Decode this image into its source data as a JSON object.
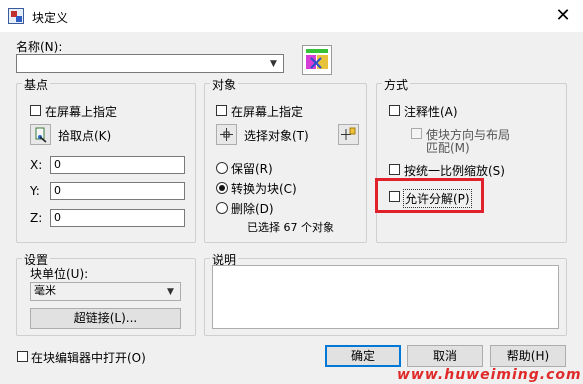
{
  "window": {
    "title": "块定义",
    "close_symbol": "✕"
  },
  "name": {
    "label": "名称(N):",
    "value": ""
  },
  "base_point": {
    "title": "基点",
    "on_screen_label": "在屏幕上指定",
    "pick_point_label": "拾取点(K)",
    "x_label": "X:",
    "x_value": "0",
    "y_label": "Y:",
    "y_value": "0",
    "z_label": "Z:",
    "z_value": "0"
  },
  "objects": {
    "title": "对象",
    "on_screen_label": "在屏幕上指定",
    "select_objects_label": "选择对象(T)",
    "retain_label": "保留(R)",
    "convert_label": "转换为块(C)",
    "delete_label": "删除(D)",
    "selected_count_label": "已选择 67 个对象",
    "selected_option": "convert"
  },
  "behavior": {
    "title": "方式",
    "annotative_label": "注释性(A)",
    "match_orientation_line1": "使块方向与布局",
    "match_orientation_line2": "匹配(M)",
    "scale_uniformly_label": "按统一比例缩放(S)",
    "allow_exploding_label": "允许分解(P)",
    "highlight_color": "#e0202a"
  },
  "settings": {
    "title": "设置",
    "block_unit_label": "块单位(U):",
    "block_unit_value": "毫米",
    "hyperlink_label": "超链接(L)..."
  },
  "description": {
    "title": "说明",
    "value": ""
  },
  "footer": {
    "open_in_editor_label": "在块编辑器中打开(O)",
    "ok_label": "确定",
    "cancel_label": "取消",
    "help_label": "帮助(H)"
  },
  "watermark": {
    "text": "www.huweiming.com",
    "color": "#e02a2a"
  },
  "icons": [
    "block-definition-icon",
    "close-icon",
    "block-preview-icon",
    "pick-point-icon",
    "select-objects-icon",
    "quick-select-icon",
    "dropdown-arrow-icon"
  ]
}
